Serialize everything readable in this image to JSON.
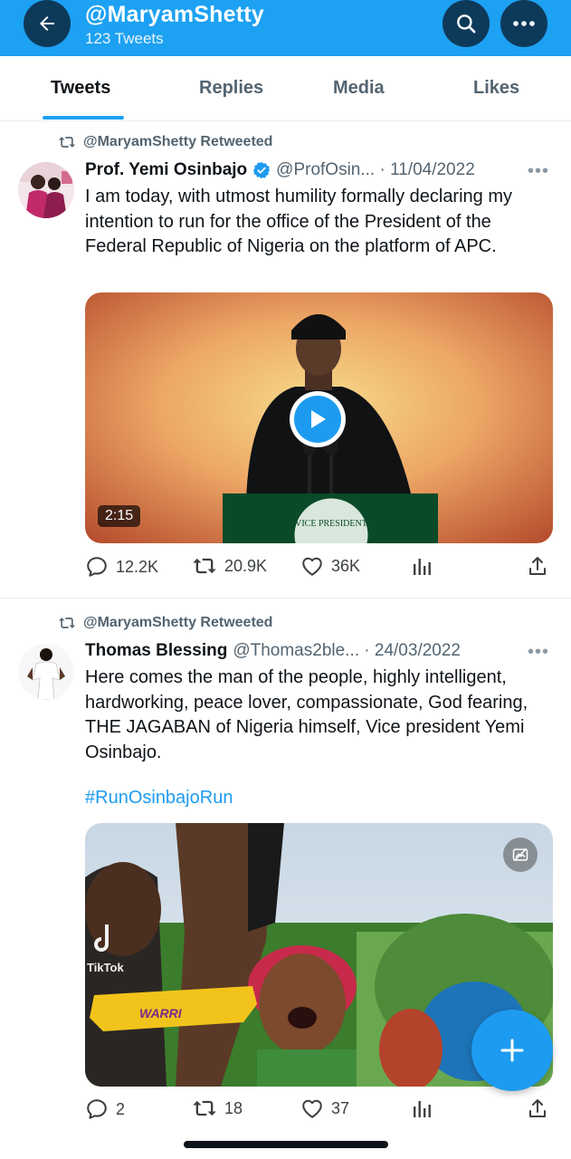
{
  "header": {
    "title": "@MaryamShetty",
    "subtitle": "123 Tweets",
    "color": "#1da1f2"
  },
  "tabs": [
    {
      "label": "Tweets",
      "active": true
    },
    {
      "label": "Replies",
      "active": false
    },
    {
      "label": "Media",
      "active": false
    },
    {
      "label": "Likes",
      "active": false
    }
  ],
  "tweets": [
    {
      "retweeted_by": "@MaryamShetty Retweeted",
      "author": "Prof. Yemi Osinbajo",
      "verified": true,
      "handle_date": "@ProfOsin... · 11/04/2022",
      "text": "I am today, with utmost humility formally declaring my intention to run for the office of the President of the Federal Republic of Nigeria on the platform of APC.",
      "media": {
        "type": "video",
        "duration": "2:15",
        "podium_text": "VICE PRESIDENT"
      },
      "stats": {
        "replies": "12.2K",
        "retweets": "20.9K",
        "likes": "36K"
      }
    },
    {
      "retweeted_by": "@MaryamShetty Retweeted",
      "author": "Thomas Blessing",
      "verified": false,
      "handle_date": "@Thomas2ble... · 24/03/2022",
      "text": "Here comes the man of the people, highly intelligent, hardworking, peace lover, compassionate, God fearing, THE JAGABAN of Nigeria himself, Vice president Yemi Osinbajo.",
      "hashtag": "#RunOsinbajoRun",
      "media": {
        "type": "video",
        "overlay_text": "WARRI",
        "watermark": "TikTok"
      },
      "stats": {
        "replies": "2",
        "retweets": "18",
        "likes": "37"
      }
    }
  ]
}
